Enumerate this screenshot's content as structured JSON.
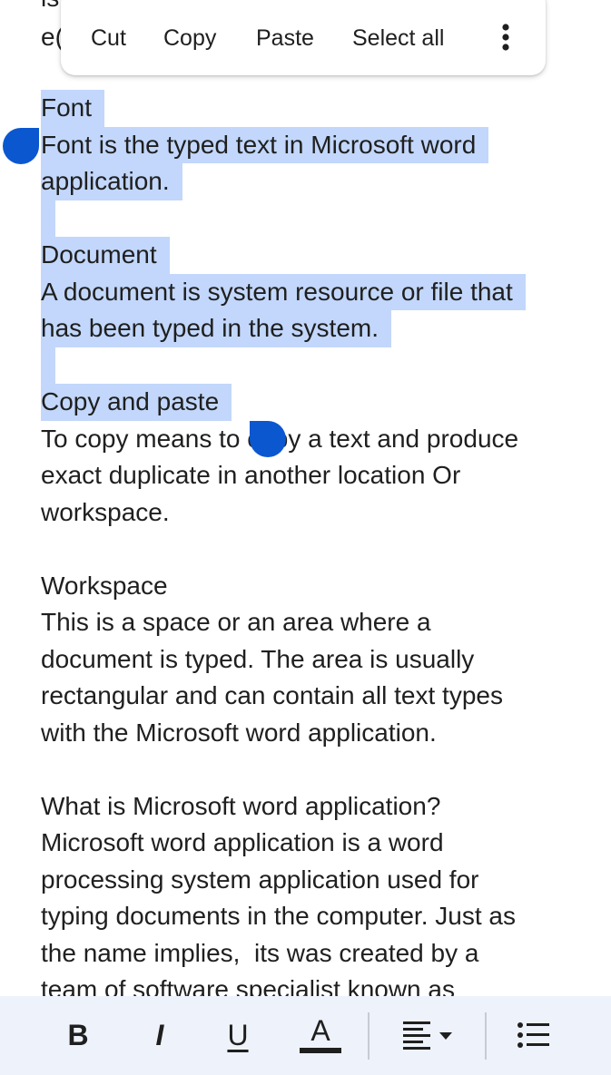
{
  "context_menu": {
    "cut": "Cut",
    "copy": "Copy",
    "paste": "Paste",
    "select_all": "Select all"
  },
  "document": {
    "partial_top": "is",
    "partial_left": "e(",
    "lines": [
      "Font",
      "Font is the typed text in Microsoft word",
      "application.",
      "",
      "Document",
      "A document is system resource or file that",
      "has been typed in the system.",
      "",
      "Copy and paste",
      "To copy means to copy a text and produce",
      "exact duplicate in another location Or",
      "workspace.",
      "",
      "Workspace",
      "This is a space or an area where a",
      "document is typed. The area is usually",
      "rectangular and can contain all text types",
      "with the Microsoft word application.",
      "",
      "What is Microsoft word application?",
      "Microsoft word application is a word",
      "processing system application used for",
      "typing documents in the computer. Just as",
      "the name implies,  its was created by a",
      "team of software specialist known as"
    ]
  },
  "toolbar": {
    "bold": "B",
    "italic": "I",
    "underline": "U",
    "text_color": "A",
    "colors": {
      "accent": "#0b57d0",
      "selection": "#c2d7fb",
      "toolbar_bg": "#eef2fa"
    }
  }
}
